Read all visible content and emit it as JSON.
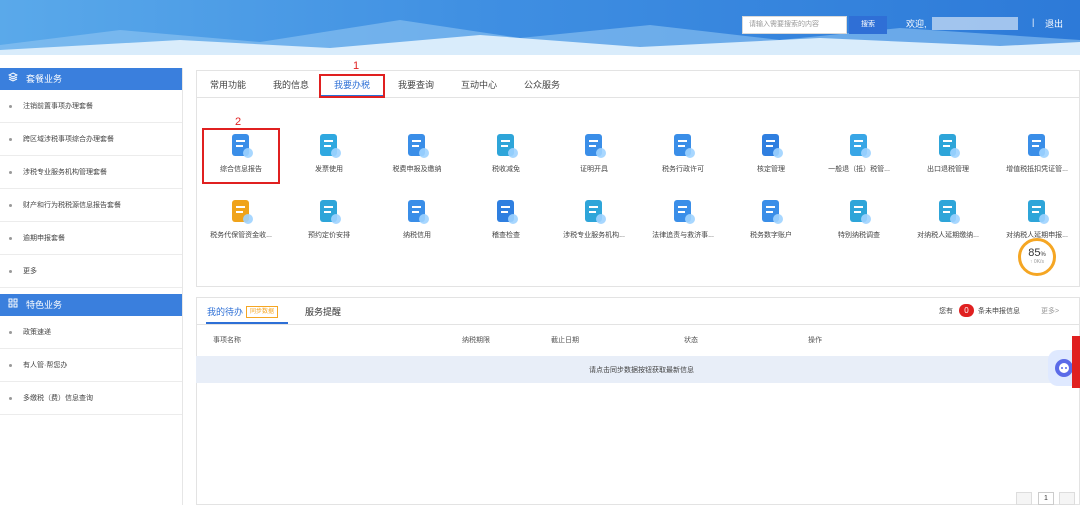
{
  "header": {
    "search_placeholder": "请输入需要搜索的内容",
    "search_button": "搜索",
    "welcome": "欢迎,",
    "separator": "|",
    "logout": "退出"
  },
  "sidebar": {
    "section1": {
      "title": "套餐业务",
      "items": [
        "注销前置事项办理套餐",
        "跨区域涉税事项综合办理套餐",
        "涉税专业服务机构管理套餐",
        "财产和行为税税源信息报告套餐",
        "逾期申报套餐",
        "更多"
      ]
    },
    "section2": {
      "title": "特色业务",
      "items": [
        "政策速递",
        "有人管·帮您办",
        "多缴税（费）信息查询"
      ]
    }
  },
  "tabs": [
    "常用功能",
    "我的信息",
    "我要办税",
    "我要查询",
    "互动中心",
    "公众服务"
  ],
  "active_tab": "我要办税",
  "annotations": {
    "step1": "1",
    "step2": "2"
  },
  "functions_row1": [
    {
      "label": "综合信息报告",
      "icon": "doc-icon"
    },
    {
      "label": "发票使用",
      "icon": "invoice-icon"
    },
    {
      "label": "税费申报及缴纳",
      "icon": "tax-payment-icon"
    },
    {
      "label": "税收减免",
      "icon": "reduction-icon"
    },
    {
      "label": "证明开具",
      "icon": "certificate-icon"
    },
    {
      "label": "税务行政许可",
      "icon": "permit-icon"
    },
    {
      "label": "核定管理",
      "icon": "approval-icon"
    },
    {
      "label": "一般退（抵）税管...",
      "icon": "refund-icon"
    },
    {
      "label": "出口退税管理",
      "icon": "export-refund-icon"
    },
    {
      "label": "增值税抵扣凭证管...",
      "icon": "voucher-icon"
    }
  ],
  "functions_row2": [
    {
      "label": "税务代保管资金收...",
      "icon": "custody-icon"
    },
    {
      "label": "预约定价安排",
      "icon": "pricing-icon"
    },
    {
      "label": "纳税信用",
      "icon": "credit-icon"
    },
    {
      "label": "稽查检查",
      "icon": "inspection-icon"
    },
    {
      "label": "涉税专业服务机构...",
      "icon": "agency-icon"
    },
    {
      "label": "法律追责与救济事...",
      "icon": "legal-icon"
    },
    {
      "label": "税务数字账户",
      "icon": "digital-account-icon"
    },
    {
      "label": "特别纳税调查",
      "icon": "investigation-icon"
    },
    {
      "label": "对纳税人延期缴纳...",
      "icon": "delay-payment-icon"
    },
    {
      "label": "对纳税人延期申报...",
      "icon": "delay-filing-icon"
    }
  ],
  "speed_badge": {
    "percent": "85",
    "unit": "%",
    "speed": "↑ 0K/s"
  },
  "bottom": {
    "tab_todo": "我的待办",
    "sync_tag": "同步数据",
    "tab_remind": "服务提醒",
    "notice_prefix": "您有",
    "count": "0",
    "notice_suffix": "条未申报信息",
    "more": "更多>",
    "columns": [
      "事项名称",
      "纳税期限",
      "截止日期",
      "状态",
      "操作"
    ],
    "empty_msg": "请点击同步数据按钮获取最新信息",
    "page": "1"
  },
  "colors": {
    "primary": "#2d6fd6",
    "annotation": "#e02020",
    "badge": "#f5a623"
  }
}
